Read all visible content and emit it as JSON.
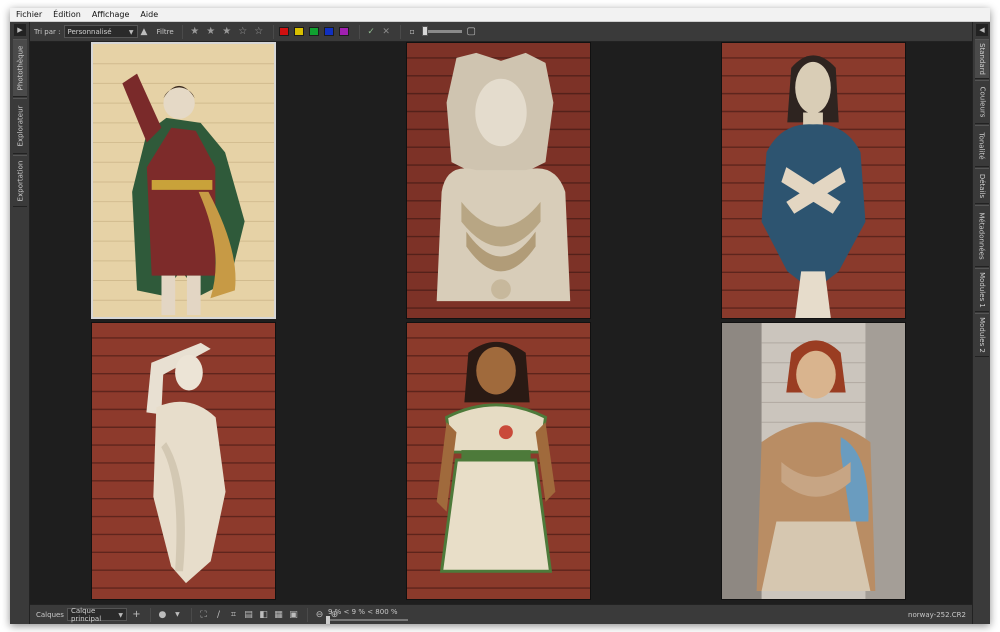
{
  "menu": {
    "items": [
      "Fichier",
      "Édition",
      "Affichage",
      "Aide"
    ]
  },
  "toolbar": {
    "sort_label": "Tri par :",
    "sort_value": "Personnalisé",
    "filter_label": "Filtre",
    "rating_stars": 5,
    "color_labels": [
      "#d01010",
      "#d8c000",
      "#10a030",
      "#1030c0",
      "#a020b0"
    ]
  },
  "left_tabs": [
    "Photothèque",
    "Explorateur",
    "Exportation"
  ],
  "right_tabs": [
    "Standard",
    "Couleurs",
    "Tonalité",
    "Détails",
    "Métadonnées",
    "Modules 1",
    "Modules 2"
  ],
  "status": {
    "layers_label": "Calques",
    "layer_value": "Calque principal",
    "zoom_text": "9 % < 9 % < 800 %",
    "filename": "norway-252.CR2"
  },
  "thumbnails": [
    {
      "name": "figurehead-horn-blower",
      "background": "#e8d4aa",
      "selected": true
    },
    {
      "name": "figurehead-crowned-bust",
      "background": "#8a3a2c",
      "selected": false
    },
    {
      "name": "figurehead-blue-robe",
      "background": "#8c3a2e",
      "selected": false
    },
    {
      "name": "figurehead-white-woman",
      "background": "#8e3b2d",
      "selected": false
    },
    {
      "name": "figurehead-green-dress",
      "background": "#8b3a2b",
      "selected": false
    },
    {
      "name": "figurehead-red-hair",
      "background": "#cfc9c2",
      "selected": false
    }
  ]
}
